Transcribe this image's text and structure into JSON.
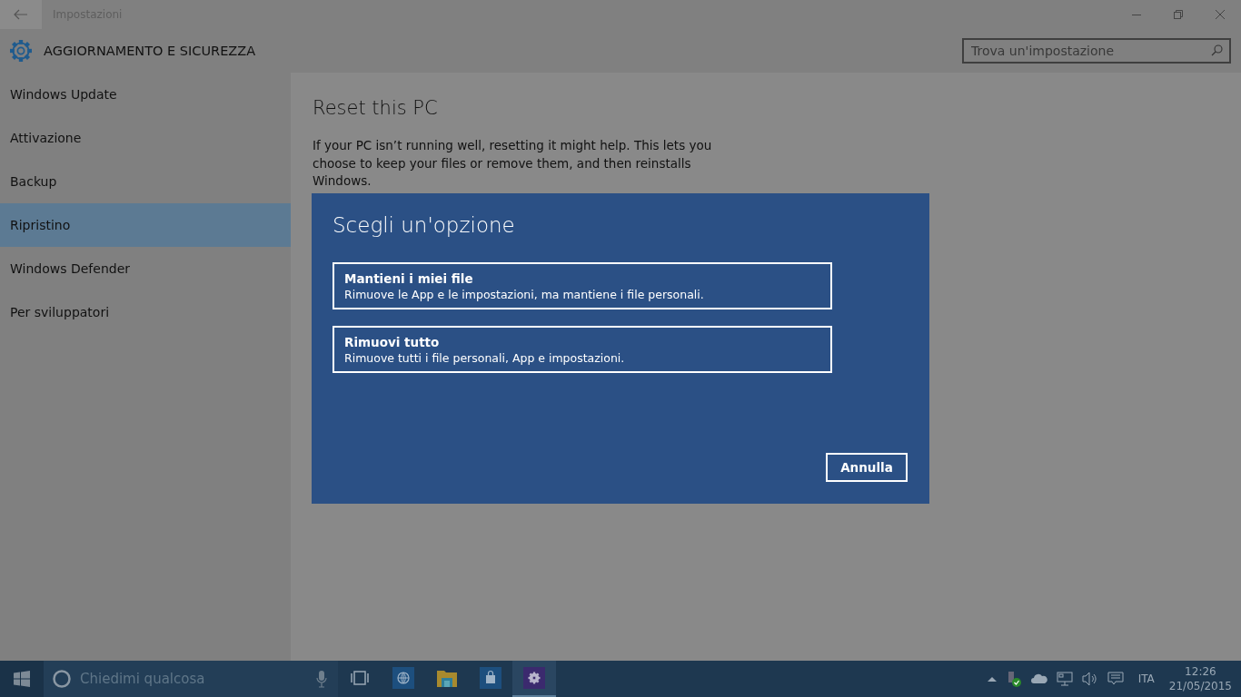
{
  "window": {
    "title": "Impostazioni"
  },
  "header": {
    "title": "AGGIORNAMENTO E SICUREZZA"
  },
  "search": {
    "placeholder": "Trova un'impostazione"
  },
  "sidebar": {
    "items": [
      {
        "label": "Windows Update",
        "selected": false
      },
      {
        "label": "Attivazione",
        "selected": false
      },
      {
        "label": "Backup",
        "selected": false
      },
      {
        "label": "Ripristino",
        "selected": true
      },
      {
        "label": "Windows Defender",
        "selected": false
      },
      {
        "label": "Per sviluppatori",
        "selected": false
      }
    ]
  },
  "content": {
    "title": "Reset this PC",
    "description": "If your PC isn’t running well, resetting it might help. This lets you choose to keep your files or remove them, and then reinstalls Windows."
  },
  "dialog": {
    "title": "Scegli un'opzione",
    "options": [
      {
        "title": "Mantieni i miei file",
        "description": "Rimuove le App e le impostazioni, ma mantiene i file personali."
      },
      {
        "title": "Rimuovi tutto",
        "description": "Rimuove tutti i file personali, App e impostazioni."
      }
    ],
    "cancel": "Annulla"
  },
  "taskbar": {
    "search_placeholder": "Chiedimi qualcosa",
    "apps": [
      {
        "kind": "task-view",
        "selected": false
      },
      {
        "kind": "browser",
        "selected": false
      },
      {
        "kind": "explorer",
        "selected": false
      },
      {
        "kind": "store",
        "selected": false
      },
      {
        "kind": "settings",
        "selected": true
      }
    ],
    "language": "ITA",
    "time": "12:26",
    "date": "21/05/2015"
  }
}
